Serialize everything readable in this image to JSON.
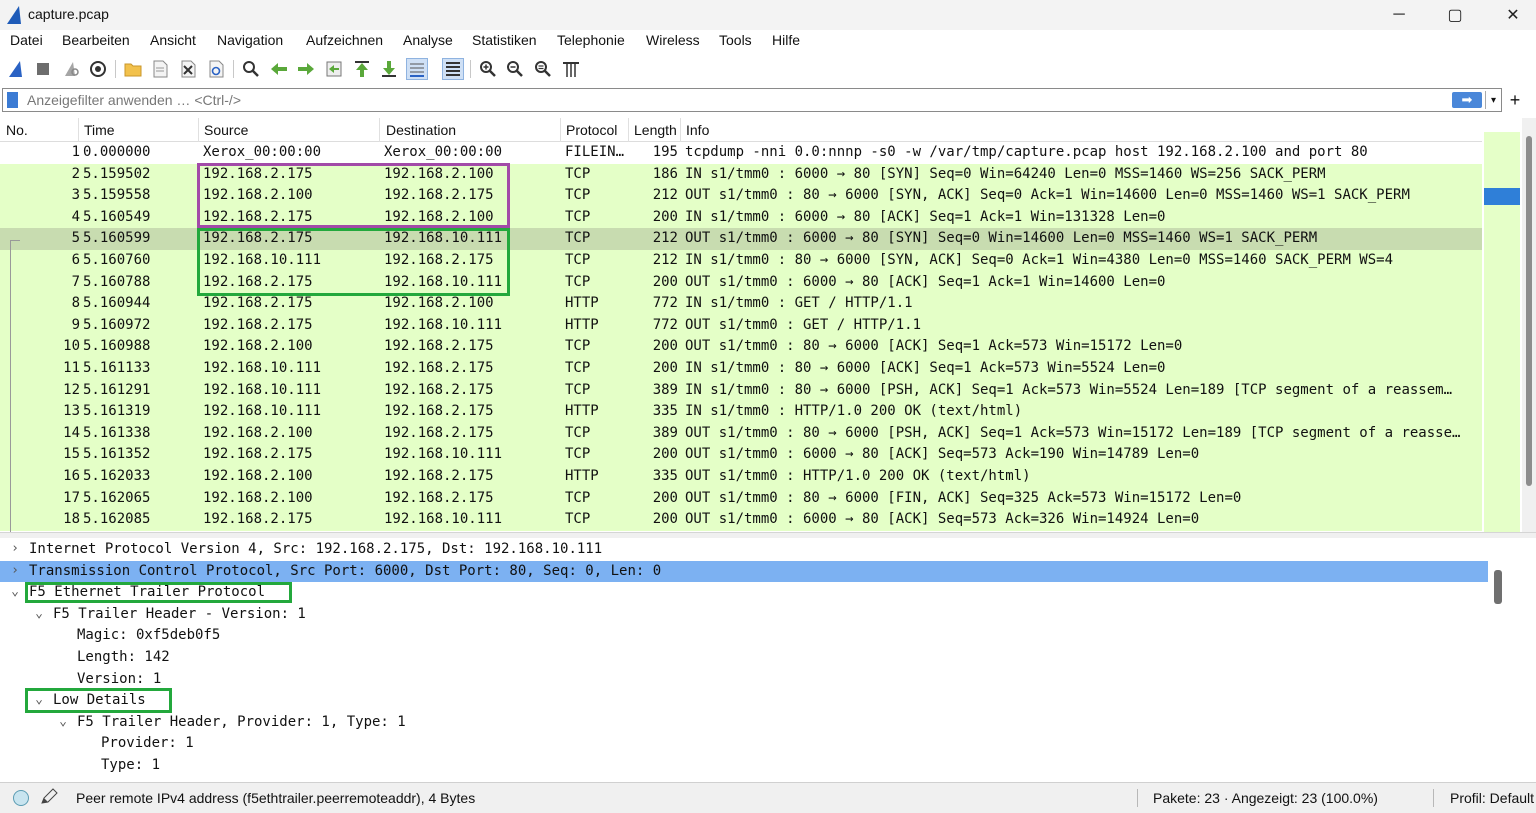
{
  "window": {
    "title": "capture.pcap",
    "minimize_label": "─",
    "maximize_label": "▢",
    "close_label": "✕"
  },
  "menu": [
    "Datei",
    "Bearbeiten",
    "Ansicht",
    "Navigation",
    "Aufzeichnen",
    "Analyse",
    "Statistiken",
    "Telephonie",
    "Wireless",
    "Tools",
    "Hilfe"
  ],
  "toolbar": {
    "icons": [
      "shark-fin-start-icon",
      "stop-capture-icon",
      "restart-capture-icon",
      "capture-options-icon",
      "open-file-icon",
      "save-file-icon",
      "close-file-icon",
      "reload-file-icon",
      "find-packet-icon",
      "go-back-icon",
      "go-forward-icon",
      "go-to-packet-icon",
      "first-packet-icon",
      "last-packet-icon",
      "autoscroll-icon",
      "colorize-icon",
      "zoom-in-icon",
      "zoom-out-icon",
      "normal-size-icon",
      "resize-columns-icon"
    ]
  },
  "filter": {
    "placeholder": "Anzeigefilter anwenden … <Ctrl-/>",
    "value": "",
    "apply_label": "➡",
    "dropdown_label": "▾",
    "add_label": "+"
  },
  "packet_list": {
    "columns": [
      "No.",
      "Time",
      "Source",
      "Destination",
      "Protocol",
      "Length",
      "Info"
    ],
    "rows": [
      {
        "no": "1",
        "time": "0.000000",
        "src": "Xerox_00:00:00",
        "dst": "Xerox_00:00:00",
        "proto": "FILEIN…",
        "len": "195",
        "info": "tcpdump -nni 0.0:nnnp -s0 -w /var/tmp/capture.pcap host 192.168.2.100 and port 80",
        "color": "#ffffff"
      },
      {
        "no": "2",
        "time": "5.159502",
        "src": "192.168.2.175",
        "dst": "192.168.2.100",
        "proto": "TCP",
        "len": "186",
        "info": "IN  s1/tmm0 : 6000 → 80 [SYN] Seq=0 Win=64240 Len=0 MSS=1460 WS=256 SACK_PERM",
        "color": "#e4ffc7"
      },
      {
        "no": "3",
        "time": "5.159558",
        "src": "192.168.2.100",
        "dst": "192.168.2.175",
        "proto": "TCP",
        "len": "212",
        "info": "OUT s1/tmm0 : 80 → 6000 [SYN, ACK] Seq=0 Ack=1 Win=14600 Len=0 MSS=1460 WS=1 SACK_PERM",
        "color": "#e4ffc7"
      },
      {
        "no": "4",
        "time": "5.160549",
        "src": "192.168.2.175",
        "dst": "192.168.2.100",
        "proto": "TCP",
        "len": "200",
        "info": "IN  s1/tmm0 : 6000 → 80 [ACK] Seq=1 Ack=1 Win=131328 Len=0",
        "color": "#e4ffc7"
      },
      {
        "no": "5",
        "time": "5.160599",
        "src": "192.168.2.175",
        "dst": "192.168.10.111",
        "proto": "TCP",
        "len": "212",
        "info": "OUT s1/tmm0 : 6000 → 80 [SYN] Seq=0 Win=14600 Len=0 MSS=1460 WS=1 SACK_PERM",
        "color": "#c8dcb0"
      },
      {
        "no": "6",
        "time": "5.160760",
        "src": "192.168.10.111",
        "dst": "192.168.2.175",
        "proto": "TCP",
        "len": "212",
        "info": "IN  s1/tmm0 : 80 → 6000 [SYN, ACK] Seq=0 Ack=1 Win=4380 Len=0 MSS=1460 SACK_PERM WS=4",
        "color": "#e4ffc7"
      },
      {
        "no": "7",
        "time": "5.160788",
        "src": "192.168.2.175",
        "dst": "192.168.10.111",
        "proto": "TCP",
        "len": "200",
        "info": "OUT s1/tmm0 : 6000 → 80 [ACK] Seq=1 Ack=1 Win=14600 Len=0",
        "color": "#e4ffc7"
      },
      {
        "no": "8",
        "time": "5.160944",
        "src": "192.168.2.175",
        "dst": "192.168.2.100",
        "proto": "HTTP",
        "len": "772",
        "info": "IN  s1/tmm0 : GET / HTTP/1.1",
        "color": "#e4ffc7"
      },
      {
        "no": "9",
        "time": "5.160972",
        "src": "192.168.2.175",
        "dst": "192.168.10.111",
        "proto": "HTTP",
        "len": "772",
        "info": "OUT s1/tmm0 : GET / HTTP/1.1",
        "color": "#e4ffc7"
      },
      {
        "no": "10",
        "time": "5.160988",
        "src": "192.168.2.100",
        "dst": "192.168.2.175",
        "proto": "TCP",
        "len": "200",
        "info": "OUT s1/tmm0 : 80 → 6000 [ACK] Seq=1 Ack=573 Win=15172 Len=0",
        "color": "#e4ffc7"
      },
      {
        "no": "11",
        "time": "5.161133",
        "src": "192.168.10.111",
        "dst": "192.168.2.175",
        "proto": "TCP",
        "len": "200",
        "info": "IN  s1/tmm0 : 80 → 6000 [ACK] Seq=1 Ack=573 Win=5524 Len=0",
        "color": "#e4ffc7"
      },
      {
        "no": "12",
        "time": "5.161291",
        "src": "192.168.10.111",
        "dst": "192.168.2.175",
        "proto": "TCP",
        "len": "389",
        "info": "IN  s1/tmm0 : 80 → 6000 [PSH, ACK] Seq=1 Ack=573 Win=5524 Len=189 [TCP segment of a reassem…",
        "color": "#e4ffc7"
      },
      {
        "no": "13",
        "time": "5.161319",
        "src": "192.168.10.111",
        "dst": "192.168.2.175",
        "proto": "HTTP",
        "len": "335",
        "info": "IN  s1/tmm0 : HTTP/1.0 200 OK  (text/html)",
        "color": "#e4ffc7"
      },
      {
        "no": "14",
        "time": "5.161338",
        "src": "192.168.2.100",
        "dst": "192.168.2.175",
        "proto": "TCP",
        "len": "389",
        "info": "OUT s1/tmm0 : 80 → 6000 [PSH, ACK] Seq=1 Ack=573 Win=15172 Len=189 [TCP segment of a reasse…",
        "color": "#e4ffc7"
      },
      {
        "no": "15",
        "time": "5.161352",
        "src": "192.168.2.175",
        "dst": "192.168.10.111",
        "proto": "TCP",
        "len": "200",
        "info": "OUT s1/tmm0 : 6000 → 80 [ACK] Seq=573 Ack=190 Win=14789 Len=0",
        "color": "#e4ffc7"
      },
      {
        "no": "16",
        "time": "5.162033",
        "src": "192.168.2.100",
        "dst": "192.168.2.175",
        "proto": "HTTP",
        "len": "335",
        "info": "OUT s1/tmm0 : HTTP/1.0 200 OK  (text/html)",
        "color": "#e4ffc7"
      },
      {
        "no": "17",
        "time": "5.162065",
        "src": "192.168.2.100",
        "dst": "192.168.2.175",
        "proto": "TCP",
        "len": "200",
        "info": "OUT s1/tmm0 : 80 → 6000 [FIN, ACK] Seq=325 Ack=573 Win=15172 Len=0",
        "color": "#e4ffc7"
      },
      {
        "no": "18",
        "time": "5.162085",
        "src": "192.168.2.175",
        "dst": "192.168.10.111",
        "proto": "TCP",
        "len": "200",
        "info": "OUT s1/tmm0 : 6000 → 80 [ACK] Seq=573 Ack=326 Win=14924 Len=0",
        "color": "#e4ffc7"
      }
    ],
    "selected_row": "5",
    "annotation_colors": {
      "purple": "#a24aa8",
      "green": "#23a83c"
    }
  },
  "details": {
    "selected_color": "#7cb1f2",
    "rows": [
      {
        "text": "Internet Protocol Version 4, Src: 192.168.2.175, Dst: 192.168.10.111",
        "arrow": "›",
        "level": 0
      },
      {
        "text": "Transmission Control Protocol, Src Port: 6000, Dst Port: 80, Seq: 0, Len: 0",
        "arrow": "›",
        "level": 0,
        "selected": true
      },
      {
        "text": "F5 Ethernet Trailer Protocol",
        "arrow": "⌄",
        "level": 0
      },
      {
        "text": "F5 Trailer Header - Version: 1",
        "arrow": "⌄",
        "level": 1
      },
      {
        "text": "Magic: 0xf5deb0f5",
        "arrow": "",
        "level": 2
      },
      {
        "text": "Length: 142",
        "arrow": "",
        "level": 2
      },
      {
        "text": "Version: 1",
        "arrow": "",
        "level": 2
      },
      {
        "text": "Low Details",
        "arrow": "⌄",
        "level": 1
      },
      {
        "text": "F5 Trailer Header, Provider: 1, Type: 1",
        "arrow": "⌄",
        "level": 2
      },
      {
        "text": "Provider: 1",
        "arrow": "",
        "level": 3
      },
      {
        "text": "Type: 1",
        "arrow": "",
        "level": 3
      }
    ]
  },
  "status": {
    "field_info": "Peer remote IPv4 address (f5ethtrailer.peerremoteaddr), 4 Bytes",
    "packets": "Pakete: 23 · Angezeigt: 23 (100.0%)",
    "profile": "Profil: Default"
  }
}
